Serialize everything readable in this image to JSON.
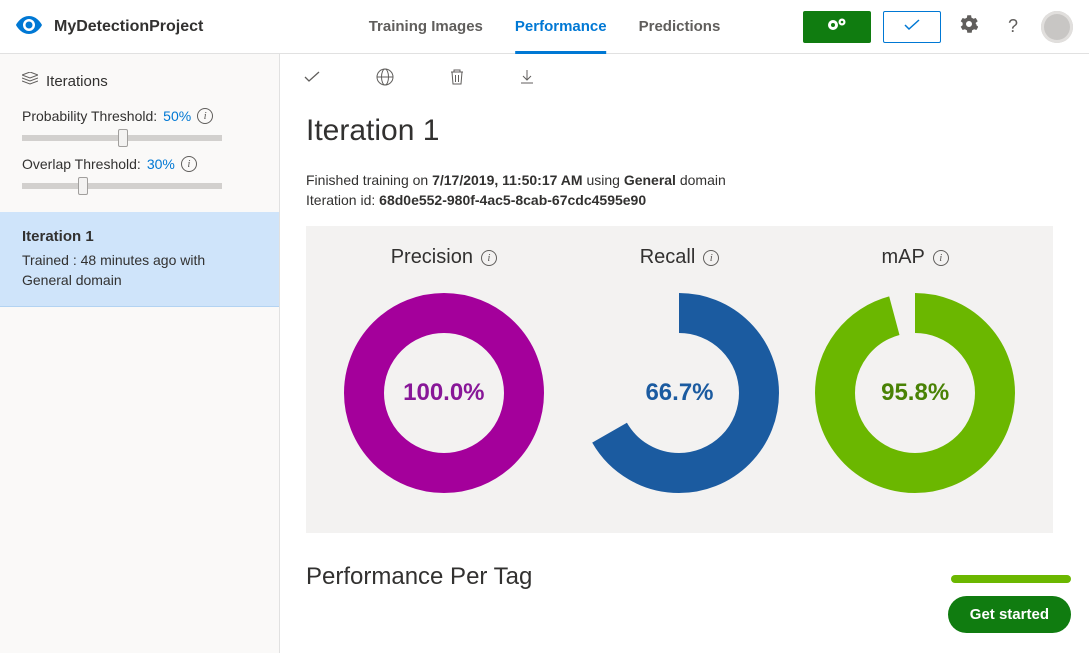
{
  "header": {
    "project_title": "MyDetectionProject",
    "tabs": [
      {
        "label": "Training Images",
        "active": false
      },
      {
        "label": "Performance",
        "active": true
      },
      {
        "label": "Predictions",
        "active": false
      }
    ]
  },
  "sidebar": {
    "iterations_label": "Iterations",
    "prob_threshold_label": "Probability Threshold:",
    "prob_threshold_value": "50%",
    "overlap_threshold_label": "Overlap Threshold:",
    "overlap_threshold_value": "30%",
    "selected_iteration": {
      "title": "Iteration 1",
      "subtitle": "Trained : 48 minutes ago with General domain"
    }
  },
  "main": {
    "heading": "Iteration 1",
    "finished_prefix": "Finished training on ",
    "finished_datetime": "7/17/2019, 11:50:17 AM",
    "finished_using": " using ",
    "finished_domain": "General",
    "finished_suffix": " domain",
    "iteration_id_label": "Iteration id: ",
    "iteration_id": "68d0e552-980f-4ac5-8cab-67cdc4595e90",
    "metrics": {
      "precision": {
        "label": "Precision",
        "value_text": "100.0%",
        "value": 100.0,
        "color": "#a4009b"
      },
      "recall": {
        "label": "Recall",
        "value_text": "66.7%",
        "value": 66.7,
        "color": "#1b5ba0"
      },
      "map": {
        "label": "mAP",
        "value_text": "95.8%",
        "value": 95.8,
        "color": "#6bb700"
      }
    },
    "perf_per_tag_heading": "Performance Per Tag",
    "get_started_label": "Get started"
  },
  "chart_data": [
    {
      "type": "pie",
      "title": "Precision",
      "categories": [
        "value",
        "remainder"
      ],
      "values": [
        100.0,
        0.0
      ],
      "ylim": [
        0,
        100
      ]
    },
    {
      "type": "pie",
      "title": "Recall",
      "categories": [
        "value",
        "remainder"
      ],
      "values": [
        66.7,
        33.3
      ],
      "ylim": [
        0,
        100
      ]
    },
    {
      "type": "pie",
      "title": "mAP",
      "categories": [
        "value",
        "remainder"
      ],
      "values": [
        95.8,
        4.2
      ],
      "ylim": [
        0,
        100
      ]
    }
  ]
}
